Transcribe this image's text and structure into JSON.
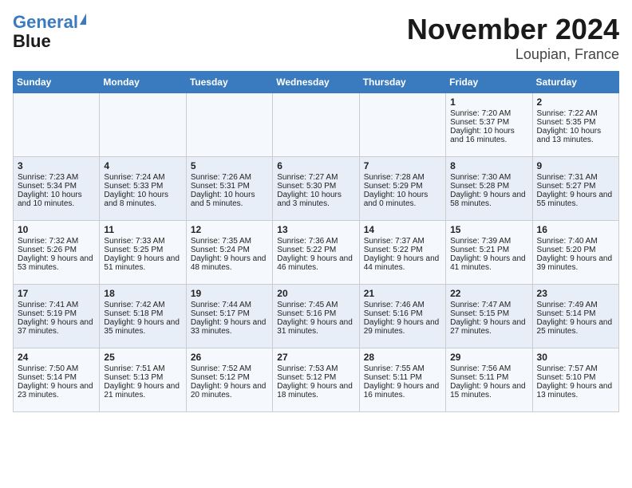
{
  "header": {
    "logo_line1": "General",
    "logo_line2": "Blue",
    "month": "November 2024",
    "location": "Loupian, France"
  },
  "weekdays": [
    "Sunday",
    "Monday",
    "Tuesday",
    "Wednesday",
    "Thursday",
    "Friday",
    "Saturday"
  ],
  "weeks": [
    [
      {
        "day": "",
        "info": ""
      },
      {
        "day": "",
        "info": ""
      },
      {
        "day": "",
        "info": ""
      },
      {
        "day": "",
        "info": ""
      },
      {
        "day": "",
        "info": ""
      },
      {
        "day": "1",
        "info": "Sunrise: 7:20 AM\nSunset: 5:37 PM\nDaylight: 10 hours and 16 minutes."
      },
      {
        "day": "2",
        "info": "Sunrise: 7:22 AM\nSunset: 5:35 PM\nDaylight: 10 hours and 13 minutes."
      }
    ],
    [
      {
        "day": "3",
        "info": "Sunrise: 7:23 AM\nSunset: 5:34 PM\nDaylight: 10 hours and 10 minutes."
      },
      {
        "day": "4",
        "info": "Sunrise: 7:24 AM\nSunset: 5:33 PM\nDaylight: 10 hours and 8 minutes."
      },
      {
        "day": "5",
        "info": "Sunrise: 7:26 AM\nSunset: 5:31 PM\nDaylight: 10 hours and 5 minutes."
      },
      {
        "day": "6",
        "info": "Sunrise: 7:27 AM\nSunset: 5:30 PM\nDaylight: 10 hours and 3 minutes."
      },
      {
        "day": "7",
        "info": "Sunrise: 7:28 AM\nSunset: 5:29 PM\nDaylight: 10 hours and 0 minutes."
      },
      {
        "day": "8",
        "info": "Sunrise: 7:30 AM\nSunset: 5:28 PM\nDaylight: 9 hours and 58 minutes."
      },
      {
        "day": "9",
        "info": "Sunrise: 7:31 AM\nSunset: 5:27 PM\nDaylight: 9 hours and 55 minutes."
      }
    ],
    [
      {
        "day": "10",
        "info": "Sunrise: 7:32 AM\nSunset: 5:26 PM\nDaylight: 9 hours and 53 minutes."
      },
      {
        "day": "11",
        "info": "Sunrise: 7:33 AM\nSunset: 5:25 PM\nDaylight: 9 hours and 51 minutes."
      },
      {
        "day": "12",
        "info": "Sunrise: 7:35 AM\nSunset: 5:24 PM\nDaylight: 9 hours and 48 minutes."
      },
      {
        "day": "13",
        "info": "Sunrise: 7:36 AM\nSunset: 5:22 PM\nDaylight: 9 hours and 46 minutes."
      },
      {
        "day": "14",
        "info": "Sunrise: 7:37 AM\nSunset: 5:22 PM\nDaylight: 9 hours and 44 minutes."
      },
      {
        "day": "15",
        "info": "Sunrise: 7:39 AM\nSunset: 5:21 PM\nDaylight: 9 hours and 41 minutes."
      },
      {
        "day": "16",
        "info": "Sunrise: 7:40 AM\nSunset: 5:20 PM\nDaylight: 9 hours and 39 minutes."
      }
    ],
    [
      {
        "day": "17",
        "info": "Sunrise: 7:41 AM\nSunset: 5:19 PM\nDaylight: 9 hours and 37 minutes."
      },
      {
        "day": "18",
        "info": "Sunrise: 7:42 AM\nSunset: 5:18 PM\nDaylight: 9 hours and 35 minutes."
      },
      {
        "day": "19",
        "info": "Sunrise: 7:44 AM\nSunset: 5:17 PM\nDaylight: 9 hours and 33 minutes."
      },
      {
        "day": "20",
        "info": "Sunrise: 7:45 AM\nSunset: 5:16 PM\nDaylight: 9 hours and 31 minutes."
      },
      {
        "day": "21",
        "info": "Sunrise: 7:46 AM\nSunset: 5:16 PM\nDaylight: 9 hours and 29 minutes."
      },
      {
        "day": "22",
        "info": "Sunrise: 7:47 AM\nSunset: 5:15 PM\nDaylight: 9 hours and 27 minutes."
      },
      {
        "day": "23",
        "info": "Sunrise: 7:49 AM\nSunset: 5:14 PM\nDaylight: 9 hours and 25 minutes."
      }
    ],
    [
      {
        "day": "24",
        "info": "Sunrise: 7:50 AM\nSunset: 5:14 PM\nDaylight: 9 hours and 23 minutes."
      },
      {
        "day": "25",
        "info": "Sunrise: 7:51 AM\nSunset: 5:13 PM\nDaylight: 9 hours and 21 minutes."
      },
      {
        "day": "26",
        "info": "Sunrise: 7:52 AM\nSunset: 5:12 PM\nDaylight: 9 hours and 20 minutes."
      },
      {
        "day": "27",
        "info": "Sunrise: 7:53 AM\nSunset: 5:12 PM\nDaylight: 9 hours and 18 minutes."
      },
      {
        "day": "28",
        "info": "Sunrise: 7:55 AM\nSunset: 5:11 PM\nDaylight: 9 hours and 16 minutes."
      },
      {
        "day": "29",
        "info": "Sunrise: 7:56 AM\nSunset: 5:11 PM\nDaylight: 9 hours and 15 minutes."
      },
      {
        "day": "30",
        "info": "Sunrise: 7:57 AM\nSunset: 5:10 PM\nDaylight: 9 hours and 13 minutes."
      }
    ]
  ]
}
